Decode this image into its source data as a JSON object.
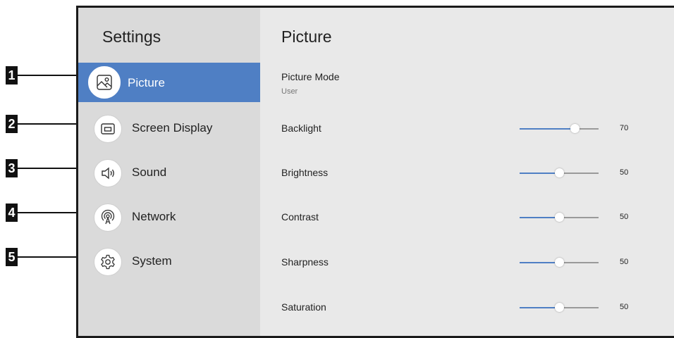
{
  "sidebar": {
    "title": "Settings",
    "items": [
      {
        "label": "Picture",
        "icon": "picture-icon",
        "active": true
      },
      {
        "label": "Screen Display",
        "icon": "screen-display-icon",
        "active": false
      },
      {
        "label": "Sound",
        "icon": "speaker-icon",
        "active": false
      },
      {
        "label": "Network",
        "icon": "network-icon",
        "active": false
      },
      {
        "label": "System",
        "icon": "gear-icon",
        "active": false
      }
    ]
  },
  "callouts": [
    "1",
    "2",
    "3",
    "4",
    "5"
  ],
  "main": {
    "title": "Picture",
    "picture_mode": {
      "label": "Picture Mode",
      "value": "User"
    },
    "settings": [
      {
        "label": "Backlight",
        "value": "70",
        "level": 0.7
      },
      {
        "label": "Brightness",
        "value": "50",
        "level": 0.5
      },
      {
        "label": "Contrast",
        "value": "50",
        "level": 0.5
      },
      {
        "label": "Sharpness",
        "value": "50",
        "level": 0.5
      },
      {
        "label": "Saturation",
        "value": "50",
        "level": 0.5
      }
    ]
  },
  "colors": {
    "accent": "#4f7fc4",
    "sidebar_bg": "#dadada",
    "content_bg": "#e9e9e9"
  }
}
